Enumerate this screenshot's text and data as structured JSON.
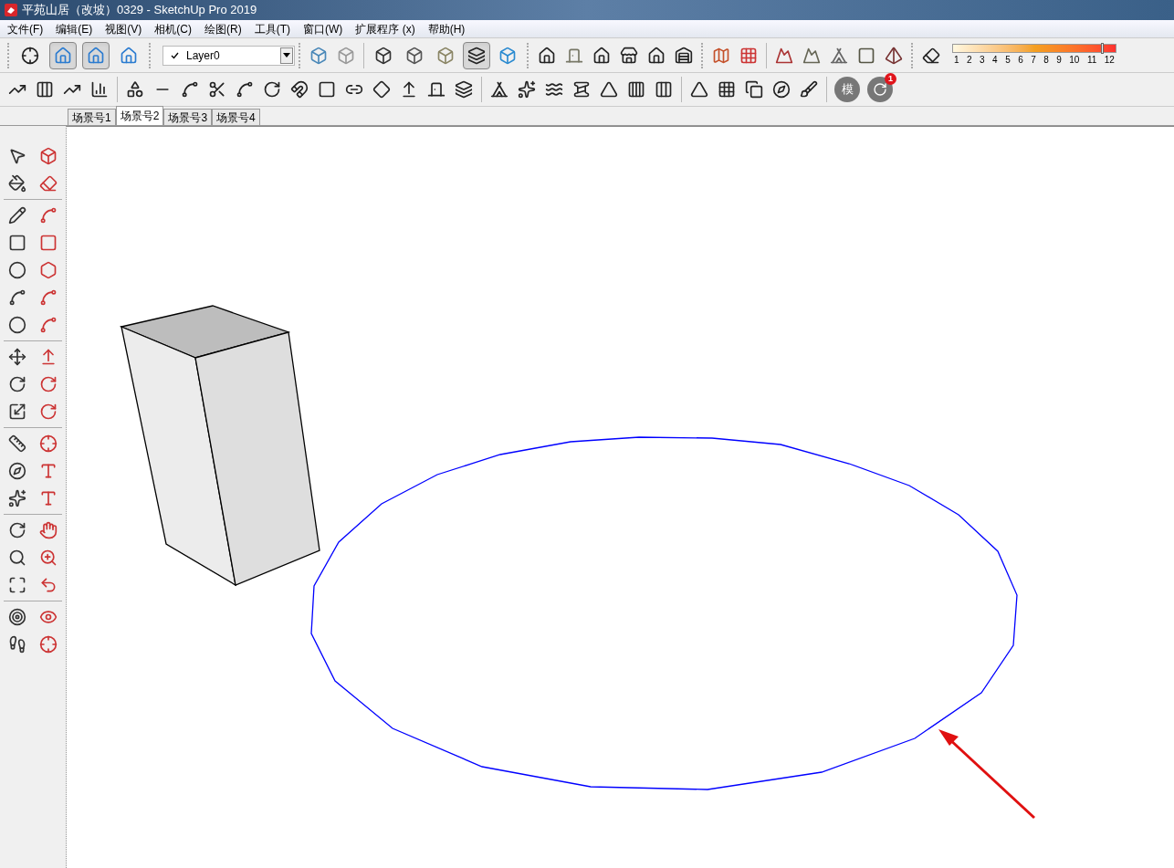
{
  "window": {
    "title": "平苑山居（改坡）0329 - SketchUp Pro 2019"
  },
  "menu": [
    "文件(F)",
    "编辑(E)",
    "视图(V)",
    "相机(C)",
    "绘图(R)",
    "工具(T)",
    "窗口(W)",
    "扩展程序 (x)",
    "帮助(H)"
  ],
  "toolbar": {
    "view_buttons": [
      {
        "selected": false
      },
      {
        "selected": true
      },
      {
        "selected": true
      },
      {
        "selected": false
      }
    ],
    "layer": {
      "checked": true,
      "value": "Layer0"
    },
    "style_buttons": [
      {
        "selected": false
      },
      {
        "selected": false
      },
      {
        "selected": false
      },
      {
        "selected": true
      },
      {
        "selected": false
      }
    ],
    "color_scale": {
      "labels": [
        "1",
        "2",
        "3",
        "4",
        "5",
        "6",
        "7",
        "8",
        "9",
        "10",
        "11",
        "12"
      ],
      "level": 0.92
    },
    "model_button": {
      "label": "模"
    },
    "update_button": {
      "badge": "1"
    }
  },
  "scene_tabs": [
    {
      "label": "场景号1",
      "selected": false
    },
    {
      "label": "场景号2",
      "selected": true
    },
    {
      "label": "场景号3",
      "selected": false
    },
    {
      "label": "场景号4",
      "selected": false
    }
  ]
}
